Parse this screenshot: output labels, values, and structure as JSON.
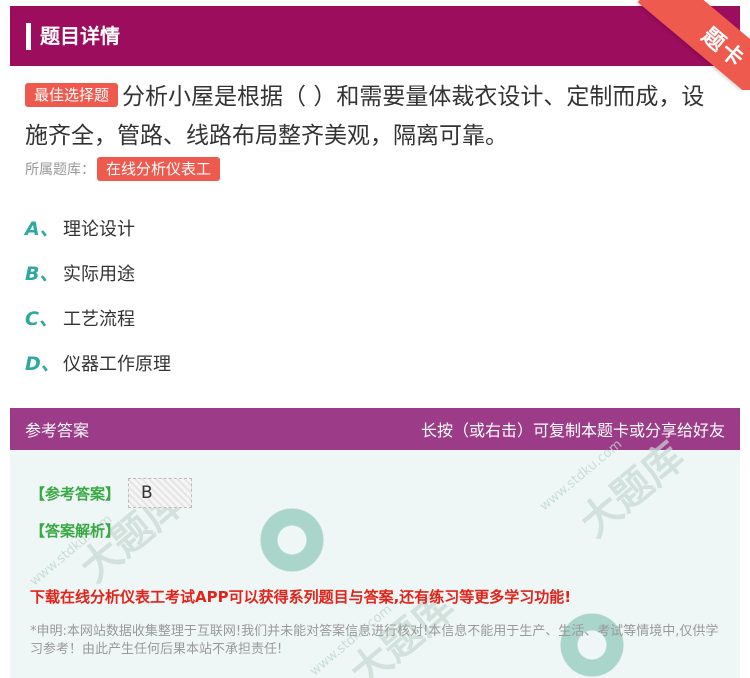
{
  "header": {
    "title": "题目详情",
    "corner_badge": "题卡"
  },
  "question": {
    "tag": "最佳选择题",
    "text": "分析小屋是根据（ ）和需要量体裁衣设计、定制而成，设施齐全，管路、线路布局整齐美观，隔离可靠。",
    "source_label": "所属题库：",
    "source_tag": "在线分析仪表工"
  },
  "options": [
    {
      "letter": "A、",
      "text": "理论设计"
    },
    {
      "letter": "B、",
      "text": "实际用途"
    },
    {
      "letter": "C、",
      "text": "工艺流程"
    },
    {
      "letter": "D、",
      "text": "仪器工作原理"
    }
  ],
  "answer": {
    "header_left": "参考答案",
    "header_right": "长按（或右击）可复制本题卡或分享给好友",
    "answer_label": "【参考答案】",
    "answer_value": "B",
    "analysis_label": "【答案解析】",
    "download_text": "下载在线分析仪表工考试APP可以获得系列题目与答案,还有练习等更多学习功能!",
    "disclaimer": "*申明:本网站数据收集整理于互联网!我们并未能对答案信息进行核对!本信息不能用于生产、生活、考试等情境中,仅供学习参考！由此产生任何后果本站不承担责任!"
  },
  "watermark": {
    "brand": "大题库",
    "domain": "www.stdku.com"
  },
  "colors": {
    "header": "#9c0d5e",
    "answer_header": "#9c3c88",
    "tag": "#ef5a4f",
    "option_letter": "#2fa7a3",
    "answer_label": "#3aa845",
    "download": "#e2231a"
  }
}
